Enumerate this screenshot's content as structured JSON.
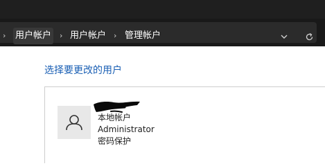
{
  "breadcrumb": {
    "items": [
      "用户帐户",
      "用户帐户",
      "管理帐户"
    ]
  },
  "address_actions": {
    "dropdown_icon": "chevron-down-icon",
    "refresh_icon": "refresh-icon"
  },
  "main": {
    "heading": "选择要更改的用户",
    "account": {
      "avatar_icon": "user-icon",
      "type": "本地帐户",
      "role": "Administrator",
      "protection": "密码保护"
    }
  },
  "colors": {
    "link": "#1a5fb4",
    "titlebar": "#1f1f1f",
    "addressbar": "#2b2b2b"
  }
}
